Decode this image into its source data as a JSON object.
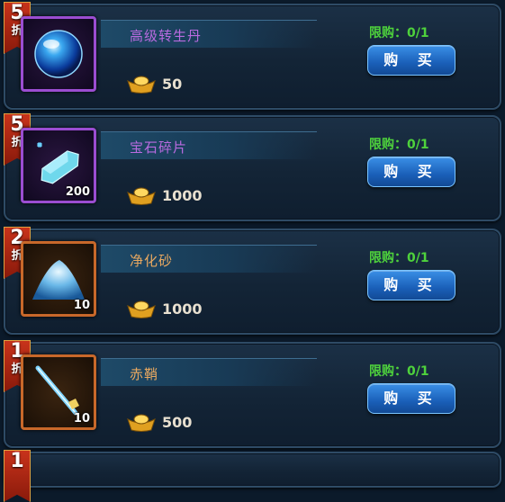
{
  "items": [
    {
      "discount": "5",
      "discount_unit": "折",
      "name": "高级转生丹",
      "name_color": "#b96be0",
      "quantity": "",
      "price": "50",
      "limit": "限购：0/1",
      "buy_label": "购 买",
      "icon": "blue-orb-icon",
      "frame": "purple"
    },
    {
      "discount": "5",
      "discount_unit": "折",
      "name": "宝石碎片",
      "name_color": "#b96be0",
      "quantity": "200",
      "price": "1000",
      "limit": "限购：0/1",
      "buy_label": "购 买",
      "icon": "gem-crystal-icon",
      "frame": "purple"
    },
    {
      "discount": "2",
      "discount_unit": "折",
      "name": "净化砂",
      "name_color": "#e8a860",
      "quantity": "10",
      "price": "1000",
      "limit": "限购：0/1",
      "buy_label": "购 买",
      "icon": "sand-pile-icon",
      "frame": "orange"
    },
    {
      "discount": "1",
      "discount_unit": "折",
      "name": "赤鞘",
      "name_color": "#e8a860",
      "quantity": "10",
      "price": "500",
      "limit": "限购：0/1",
      "buy_label": "购 买",
      "icon": "ice-sword-icon",
      "frame": "orange"
    }
  ],
  "partial_item": {
    "discount": "1"
  }
}
